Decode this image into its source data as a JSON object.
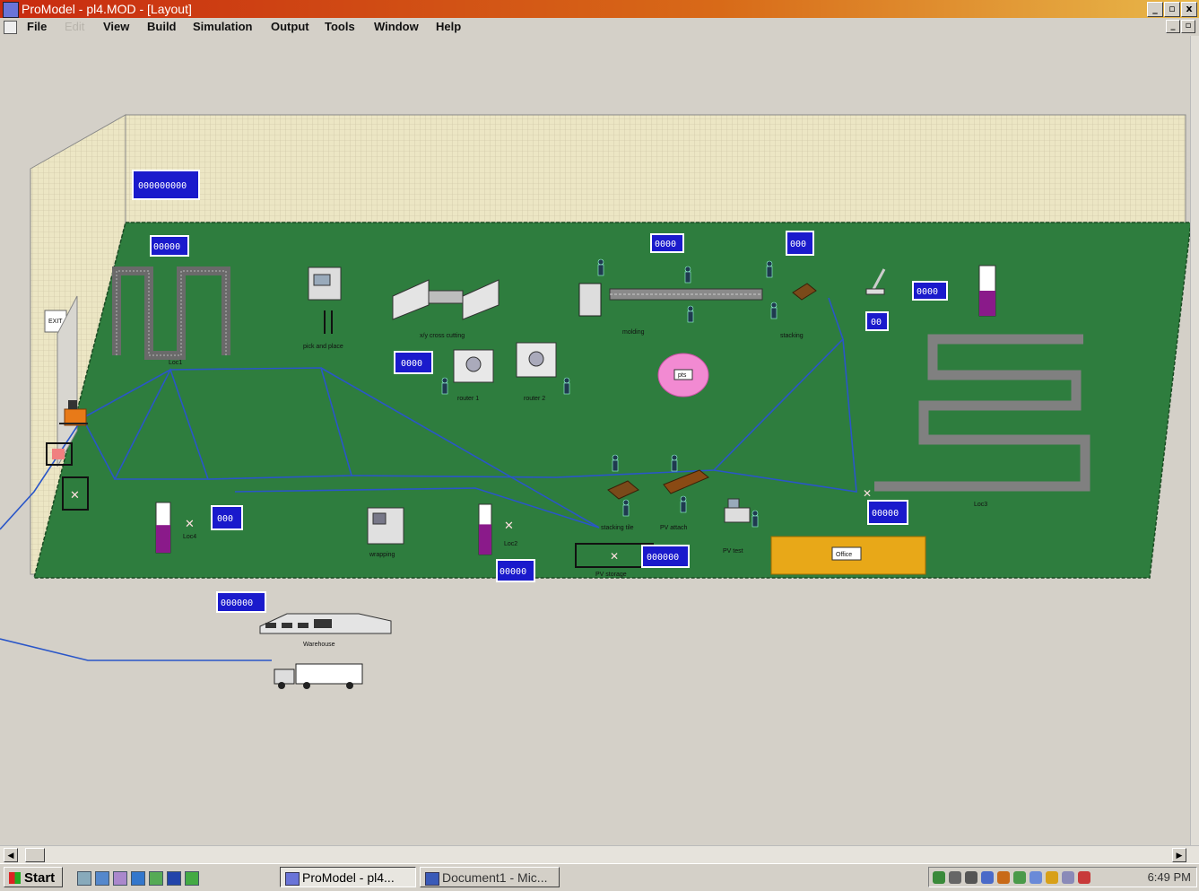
{
  "window": {
    "title": "ProModel - pl4.MOD - [Layout]",
    "buttons": [
      "_",
      "▫",
      "x"
    ],
    "mdi_buttons": [
      "_",
      "▫"
    ]
  },
  "menu": [
    {
      "label": "File",
      "enabled": true
    },
    {
      "label": "Edit",
      "enabled": false
    },
    {
      "label": "View",
      "enabled": true
    },
    {
      "label": "Build",
      "enabled": true
    },
    {
      "label": "Simulation",
      "enabled": true
    },
    {
      "label": "Output",
      "enabled": true
    },
    {
      "label": "Tools",
      "enabled": true
    },
    {
      "label": "Window",
      "enabled": true
    },
    {
      "label": "Help",
      "enabled": true
    }
  ],
  "layout": {
    "colors": {
      "floor": "#2e7d3e",
      "wall": "#ece6c4",
      "counter_bg": "#1a1acc",
      "route": "#2a56c8",
      "office": "#e8a818",
      "gauge_fill": "#8a1a8a",
      "pink_station": "#f28ad2"
    },
    "counters": [
      {
        "id": "big",
        "value": "000000000"
      },
      {
        "id": "loc1",
        "value": "00000"
      },
      {
        "id": "mid1",
        "value": "0000"
      },
      {
        "id": "top-conveyor",
        "value": "0000"
      },
      {
        "id": "top-right",
        "value": "000"
      },
      {
        "id": "right1",
        "value": "0000"
      },
      {
        "id": "right2",
        "value": "00"
      },
      {
        "id": "loc4",
        "value": "000"
      },
      {
        "id": "loc2-bottom",
        "value": "00000"
      },
      {
        "id": "pvstorage",
        "value": "000000"
      },
      {
        "id": "loc3",
        "value": "00000"
      },
      {
        "id": "warehouse",
        "value": "000000"
      }
    ],
    "labels": {
      "exit": "EXIT",
      "loc1": "Loc1",
      "pick_and_place": "pick and place",
      "cross_cutting": "x/y cross cutting",
      "molding": "molding",
      "stacking": "stacking",
      "router1": "router 1",
      "router2": "router 2",
      "pink": "pts",
      "loc3": "Loc3",
      "loc4": "Loc4",
      "wrapping": "wrapping",
      "loc2": "Loc2",
      "stacking_tile": "stacking tile",
      "pv_attach": "PV attach",
      "pv_test": "PV test",
      "pv_storage": "PV storage",
      "office": "Office",
      "warehouse": "Warehouse"
    },
    "gauges": [
      {
        "id": "right",
        "level": 0.5
      },
      {
        "id": "loc4",
        "level": 0.55
      },
      {
        "id": "loc2",
        "level": 0.6
      }
    ]
  },
  "taskbar": {
    "start_label": "Start",
    "tasks": [
      {
        "label": "ProModel - pl4...",
        "active": true
      },
      {
        "label": "Document1 - Mic...",
        "active": false
      }
    ],
    "clock": "6:49 PM"
  }
}
